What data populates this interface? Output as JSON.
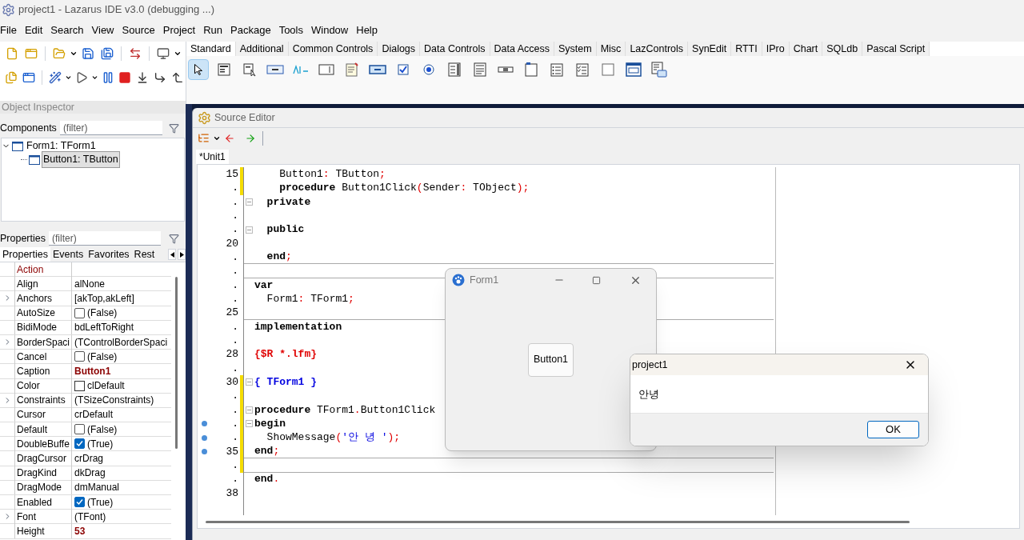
{
  "window": {
    "title": "project1 - Lazarus IDE v3.0 (debugging ...)"
  },
  "menu": [
    "File",
    "Edit",
    "Search",
    "View",
    "Source",
    "Project",
    "Run",
    "Package",
    "Tools",
    "Window",
    "Help"
  ],
  "palette": {
    "tabs": [
      {
        "label": "Standard",
        "selected": true
      },
      {
        "label": "Additional",
        "selected": false
      },
      {
        "label": "Common Controls",
        "selected": false
      },
      {
        "label": "Dialogs",
        "selected": false
      },
      {
        "label": "Data Controls",
        "selected": false
      },
      {
        "label": "Data Access",
        "selected": false
      },
      {
        "label": "System",
        "selected": false
      },
      {
        "label": "Misc",
        "selected": false
      },
      {
        "label": "LazControls",
        "selected": false
      },
      {
        "label": "SynEdit",
        "selected": false
      },
      {
        "label": "RTTI",
        "selected": false
      },
      {
        "label": "IPro",
        "selected": false
      },
      {
        "label": "Chart",
        "selected": false
      },
      {
        "label": "SQLdb",
        "selected": false
      },
      {
        "label": "Pascal Script",
        "selected": false
      }
    ],
    "tools": [
      {
        "kind": "pointer",
        "selected": true
      },
      {
        "kind": "mainmenu",
        "selected": false
      },
      {
        "kind": "popupmenu",
        "selected": false
      },
      {
        "kind": "button",
        "selected": false
      },
      {
        "kind": "label",
        "selected": false
      },
      {
        "kind": "edit",
        "selected": false
      },
      {
        "kind": "memo",
        "selected": false
      },
      {
        "kind": "togglebox",
        "selected": false
      },
      {
        "kind": "checkbox",
        "selected": false
      },
      {
        "kind": "radiobutton",
        "selected": false
      },
      {
        "kind": "listbox",
        "selected": false
      },
      {
        "kind": "combobox",
        "selected": false
      },
      {
        "kind": "scrollbar",
        "selected": false
      },
      {
        "kind": "groupbox",
        "selected": false
      },
      {
        "kind": "radiogroup",
        "selected": false
      },
      {
        "kind": "checkgroup",
        "selected": false
      },
      {
        "kind": "panel",
        "selected": false
      },
      {
        "kind": "frame",
        "selected": false
      },
      {
        "kind": "actionlist",
        "selected": false
      }
    ]
  },
  "object_inspector": {
    "title": "Object Inspector",
    "components_label": "Components",
    "components_filter": {
      "placeholder": "(filter)"
    },
    "tree": [
      {
        "label": "Form1: TForm1",
        "expanded": true,
        "selected": false,
        "children": [
          {
            "label": "Button1: TButton",
            "selected": true
          }
        ]
      }
    ],
    "properties_label": "Properties",
    "properties_filter": {
      "placeholder": "(filter)"
    },
    "tabs": [
      {
        "label": "Properties",
        "selected": true
      },
      {
        "label": "Events",
        "selected": false
      },
      {
        "label": "Favorites",
        "selected": false
      },
      {
        "label": "Rest",
        "selected": false
      }
    ],
    "properties": [
      {
        "name": "Action",
        "kind": "reference",
        "expandable": false
      },
      {
        "name": "Align",
        "kind": "text",
        "value": "alNone",
        "expandable": false,
        "modified": false
      },
      {
        "name": "Anchors",
        "kind": "text",
        "value": "[akTop,akLeft]",
        "expandable": true,
        "modified": false
      },
      {
        "name": "AutoSize",
        "kind": "checkbox",
        "value": "(False)",
        "checked": false,
        "expandable": false
      },
      {
        "name": "BidiMode",
        "kind": "text",
        "value": "bdLeftToRight",
        "expandable": false,
        "modified": false
      },
      {
        "name": "BorderSpaci",
        "kind": "text",
        "value": "(TControlBorderSpaci",
        "expandable": true,
        "modified": false
      },
      {
        "name": "Cancel",
        "kind": "checkbox",
        "value": "(False)",
        "checked": false,
        "expandable": false
      },
      {
        "name": "Caption",
        "kind": "text",
        "value": "Button1",
        "expandable": false,
        "modified": true
      },
      {
        "name": "Color",
        "kind": "color",
        "value": "clDefault",
        "expandable": false
      },
      {
        "name": "Constraints",
        "kind": "text",
        "value": "(TSizeConstraints)",
        "expandable": true,
        "modified": false
      },
      {
        "name": "Cursor",
        "kind": "text",
        "value": "crDefault",
        "expandable": false,
        "modified": false
      },
      {
        "name": "Default",
        "kind": "checkbox",
        "value": "(False)",
        "checked": false,
        "expandable": false
      },
      {
        "name": "DoubleBuffe",
        "kind": "checkbox",
        "value": "(True)",
        "checked": true,
        "expandable": false
      },
      {
        "name": "DragCursor",
        "kind": "text",
        "value": "crDrag",
        "expandable": false,
        "modified": false
      },
      {
        "name": "DragKind",
        "kind": "text",
        "value": "dkDrag",
        "expandable": false,
        "modified": false
      },
      {
        "name": "DragMode",
        "kind": "text",
        "value": "dmManual",
        "expandable": false,
        "modified": false
      },
      {
        "name": "Enabled",
        "kind": "checkbox",
        "value": "(True)",
        "checked": true,
        "expandable": false
      },
      {
        "name": "Font",
        "kind": "text",
        "value": "(TFont)",
        "expandable": true,
        "modified": false
      },
      {
        "name": "Height",
        "kind": "text",
        "value": "53",
        "expandable": false,
        "modified": true
      }
    ]
  },
  "source_editor": {
    "title": "Source Editor",
    "tabs": [
      {
        "label": "*Unit1",
        "selected": true
      }
    ],
    "lines": [
      {
        "gutter": "15",
        "modified": true,
        "breakpoint": false,
        "fold": false,
        "divider": false,
        "tokens": [
          {
            "kind": "text",
            "text": "    Button1"
          },
          {
            "kind": "symbol",
            "text": ":"
          },
          {
            "kind": "text",
            "text": " TButton"
          },
          {
            "kind": "symbol",
            "text": ";"
          }
        ]
      },
      {
        "gutter": ".",
        "modified": true,
        "breakpoint": false,
        "fold": false,
        "divider": false,
        "tokens": [
          {
            "kind": "keyword",
            "text": "    procedure"
          },
          {
            "kind": "text",
            "text": " Button1Click"
          },
          {
            "kind": "symbol",
            "text": "("
          },
          {
            "kind": "text",
            "text": "Sender"
          },
          {
            "kind": "symbol",
            "text": ":"
          },
          {
            "kind": "text",
            "text": " TObject"
          },
          {
            "kind": "symbol",
            "text": ");"
          }
        ]
      },
      {
        "gutter": ".",
        "modified": false,
        "breakpoint": false,
        "fold": true,
        "divider": false,
        "tokens": [
          {
            "kind": "keyword",
            "text": "  private"
          }
        ]
      },
      {
        "gutter": ".",
        "modified": false,
        "breakpoint": false,
        "fold": false,
        "divider": false
      },
      {
        "gutter": ".",
        "modified": false,
        "breakpoint": false,
        "fold": true,
        "divider": false,
        "tokens": [
          {
            "kind": "keyword",
            "text": "  public"
          }
        ]
      },
      {
        "gutter": "20",
        "modified": false,
        "breakpoint": false,
        "fold": false,
        "divider": false
      },
      {
        "gutter": ".",
        "modified": false,
        "breakpoint": false,
        "fold": false,
        "divider": true,
        "tokens": [
          {
            "kind": "keyword",
            "text": "  end"
          },
          {
            "kind": "symbol",
            "text": ";"
          }
        ]
      },
      {
        "gutter": ".",
        "modified": false,
        "breakpoint": false,
        "fold": false,
        "divider": true
      },
      {
        "gutter": ".",
        "modified": false,
        "breakpoint": false,
        "fold": false,
        "divider": false,
        "tokens": [
          {
            "kind": "keyword",
            "text": "var"
          }
        ]
      },
      {
        "gutter": ".",
        "modified": false,
        "breakpoint": false,
        "fold": false,
        "divider": false,
        "tokens": [
          {
            "kind": "text",
            "text": "  Form1"
          },
          {
            "kind": "symbol",
            "text": ":"
          },
          {
            "kind": "text",
            "text": " TForm1"
          },
          {
            "kind": "symbol",
            "text": ";"
          }
        ]
      },
      {
        "gutter": "25",
        "modified": false,
        "breakpoint": false,
        "fold": false,
        "divider": true
      },
      {
        "gutter": ".",
        "modified": false,
        "breakpoint": false,
        "fold": false,
        "divider": false,
        "tokens": [
          {
            "kind": "keyword",
            "text": "implementation"
          }
        ]
      },
      {
        "gutter": ".",
        "modified": false,
        "breakpoint": false,
        "fold": false,
        "divider": false
      },
      {
        "gutter": "28",
        "modified": false,
        "breakpoint": false,
        "fold": false,
        "divider": false,
        "tokens": [
          {
            "kind": "directive",
            "text": "{$R *.lfm}"
          }
        ]
      },
      {
        "gutter": ".",
        "modified": false,
        "breakpoint": false,
        "fold": false,
        "divider": false
      },
      {
        "gutter": "30",
        "modified": true,
        "breakpoint": false,
        "fold": true,
        "divider": false,
        "tokens": [
          {
            "kind": "comment",
            "text": "{ TForm1 }"
          }
        ]
      },
      {
        "gutter": ".",
        "modified": true,
        "breakpoint": false,
        "fold": false,
        "divider": false
      },
      {
        "gutter": ".",
        "modified": true,
        "breakpoint": false,
        "fold": true,
        "divider": false,
        "tokens": [
          {
            "kind": "keyword",
            "text": "procedure"
          },
          {
            "kind": "text",
            "text": " TForm1"
          },
          {
            "kind": "symbol",
            "text": "."
          },
          {
            "kind": "text",
            "text": "Button1Click"
          }
        ]
      },
      {
        "gutter": ".",
        "modified": true,
        "breakpoint": true,
        "fold": true,
        "divider": false,
        "tokens": [
          {
            "kind": "keyword",
            "text": "begin"
          }
        ]
      },
      {
        "gutter": ".",
        "modified": true,
        "breakpoint": true,
        "fold": false,
        "divider": false,
        "tokens": [
          {
            "kind": "text",
            "text": "  ShowMessage"
          },
          {
            "kind": "symbol",
            "text": "("
          },
          {
            "kind": "string",
            "text": "'안 녕 '"
          },
          {
            "kind": "symbol",
            "text": ");"
          }
        ]
      },
      {
        "gutter": "35",
        "modified": true,
        "breakpoint": true,
        "fold": false,
        "divider": true,
        "tokens": [
          {
            "kind": "keyword",
            "text": "end"
          },
          {
            "kind": "symbol",
            "text": ";"
          }
        ]
      },
      {
        "gutter": ".",
        "modified": true,
        "breakpoint": false,
        "fold": false,
        "divider": true
      },
      {
        "gutter": ".",
        "modified": false,
        "breakpoint": false,
        "fold": false,
        "divider": false,
        "tokens": [
          {
            "kind": "keyword",
            "text": "end"
          },
          {
            "kind": "symbol",
            "text": "."
          }
        ]
      },
      {
        "gutter": "38",
        "modified": false,
        "breakpoint": false,
        "fold": false,
        "divider": false
      }
    ]
  },
  "form_window": {
    "title": "Form1",
    "button": "Button1"
  },
  "message_dialog": {
    "title": "project1",
    "message": "안녕",
    "button": "OK"
  }
}
